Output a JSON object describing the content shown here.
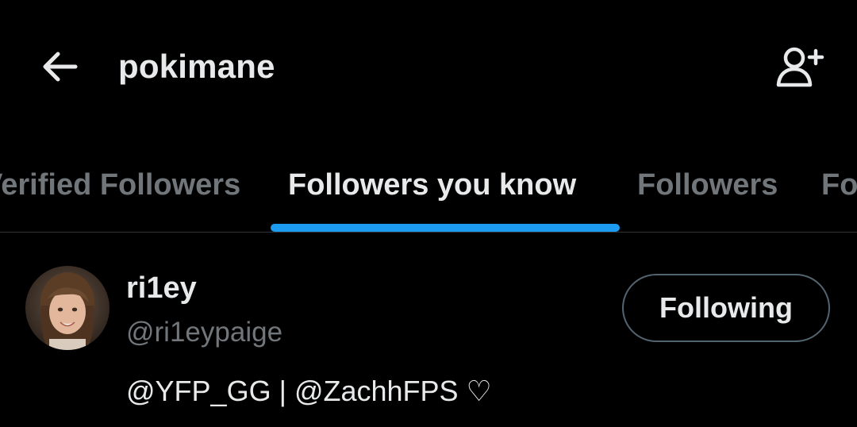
{
  "header": {
    "title": "pokimane",
    "back_icon": "arrow-left-icon",
    "add_user_icon": "person-plus-icon"
  },
  "tabs": [
    {
      "label": "Verified Followers",
      "active": false
    },
    {
      "label": "Followers you know",
      "active": true
    },
    {
      "label": "Followers",
      "active": false
    },
    {
      "label": "Following",
      "active": false
    }
  ],
  "colors": {
    "background": "#000000",
    "accent": "#1d9bf0",
    "text_primary": "#e7e9ea",
    "text_secondary": "#71767b",
    "border": "#2f3336"
  },
  "user": {
    "display_name": "ri1ey",
    "handle": "@ri1eypaige",
    "bio": "@YFP_GG | @ZachhFPS ♡",
    "follow_button_label": "Following"
  }
}
